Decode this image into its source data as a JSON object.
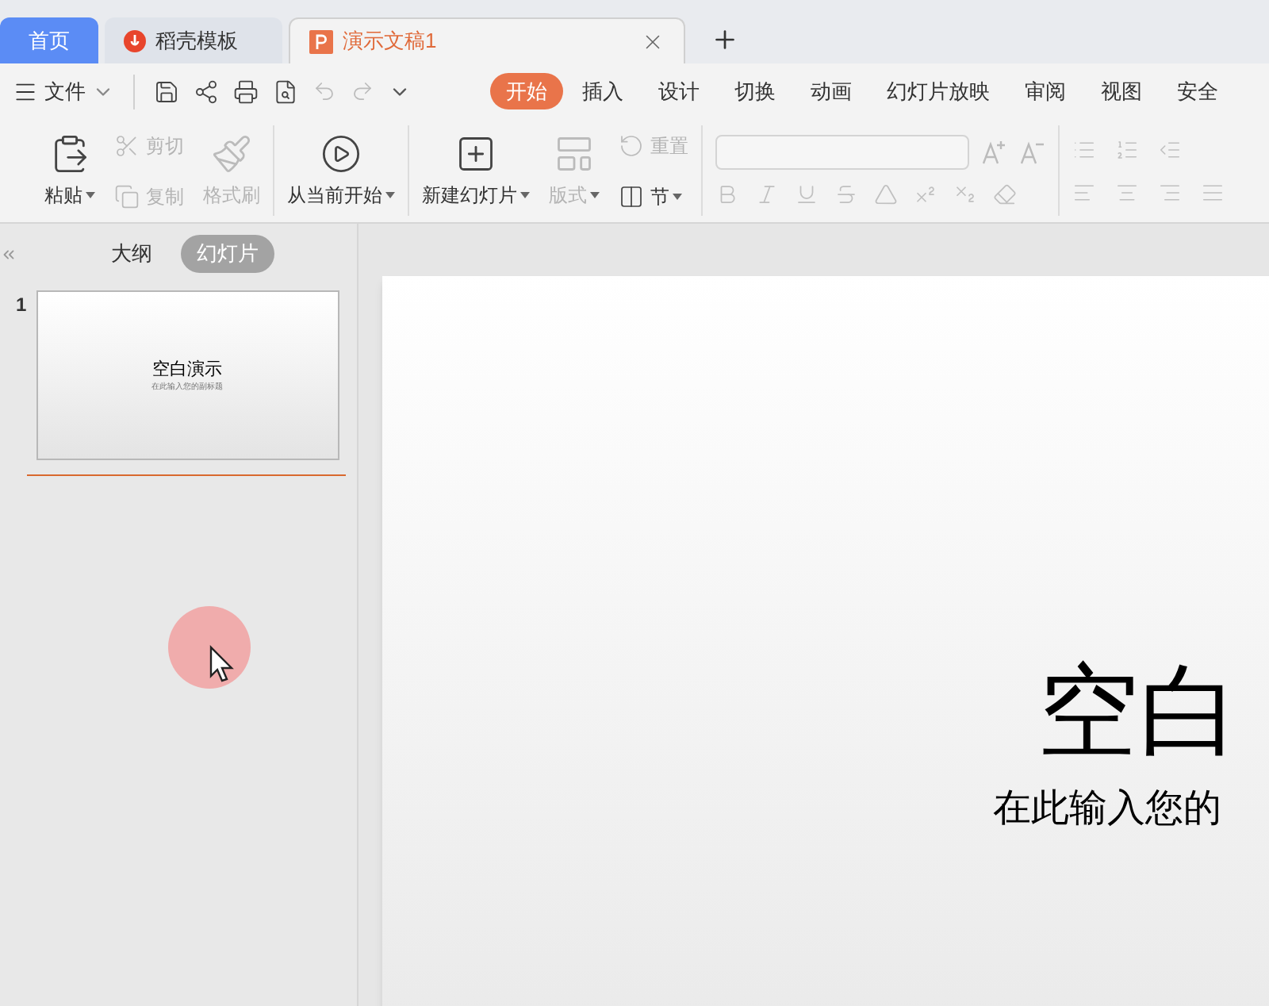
{
  "window_tabs": [
    {
      "label": "首页",
      "kind": "home",
      "selected": false
    },
    {
      "label": "稻壳模板",
      "kind": "template",
      "selected": false
    },
    {
      "label": "演示文稿1",
      "kind": "doc",
      "selected": true
    }
  ],
  "file_menu": {
    "label": "文件"
  },
  "ribbon_tabs": [
    {
      "label": "开始",
      "selected": true
    },
    {
      "label": "插入",
      "selected": false
    },
    {
      "label": "设计",
      "selected": false
    },
    {
      "label": "切换",
      "selected": false
    },
    {
      "label": "动画",
      "selected": false
    },
    {
      "label": "幻灯片放映",
      "selected": false
    },
    {
      "label": "审阅",
      "selected": false
    },
    {
      "label": "视图",
      "selected": false
    },
    {
      "label": "安全",
      "selected": false
    }
  ],
  "ribbon": {
    "clipboard": [
      {
        "label": "粘贴",
        "kind": "large",
        "dropdown": true,
        "disabled": false
      },
      {
        "label": "剪切",
        "kind": "small",
        "dropdown": false,
        "disabled": true
      },
      {
        "label": "复制",
        "kind": "small",
        "dropdown": false,
        "disabled": true
      },
      {
        "label": "格式刷",
        "kind": "large",
        "dropdown": false,
        "disabled": true
      }
    ],
    "show": [
      {
        "label": "从当前开始",
        "kind": "large",
        "dropdown": true,
        "disabled": false
      }
    ],
    "slides": [
      {
        "label": "新建幻灯片",
        "kind": "large",
        "dropdown": true,
        "disabled": false
      },
      {
        "label": "版式",
        "kind": "large",
        "dropdown": true,
        "disabled": true
      },
      {
        "label": "重置",
        "kind": "small",
        "dropdown": false,
        "disabled": true
      },
      {
        "label": "节",
        "kind": "small",
        "dropdown": true,
        "disabled": false
      }
    ]
  },
  "panel": {
    "views": [
      {
        "label": "大纲",
        "selected": false
      },
      {
        "label": "幻灯片",
        "selected": true
      }
    ],
    "slides": [
      {
        "number": "1",
        "title": "空白演示",
        "subtitle": "在此输入您的副标题",
        "selected": true
      }
    ]
  },
  "slide": {
    "title": "空白",
    "subtitle": "在此输入您的"
  }
}
